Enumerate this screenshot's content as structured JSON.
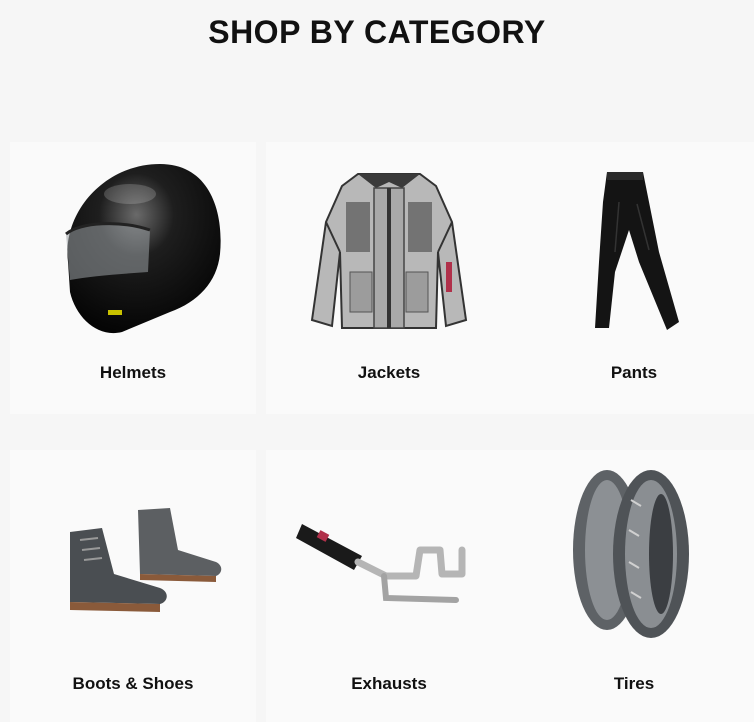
{
  "header": {
    "title": "SHOP BY CATEGORY"
  },
  "categories": [
    {
      "label": "Helmets",
      "icon": "helmet-icon"
    },
    {
      "label": "Jackets",
      "icon": "jacket-icon"
    },
    {
      "label": "Pants",
      "icon": "pants-icon"
    },
    {
      "label": "Boots & Shoes",
      "icon": "boots-icon"
    },
    {
      "label": "Exhausts",
      "icon": "exhaust-icon"
    },
    {
      "label": "Tires",
      "icon": "tires-icon"
    }
  ]
}
